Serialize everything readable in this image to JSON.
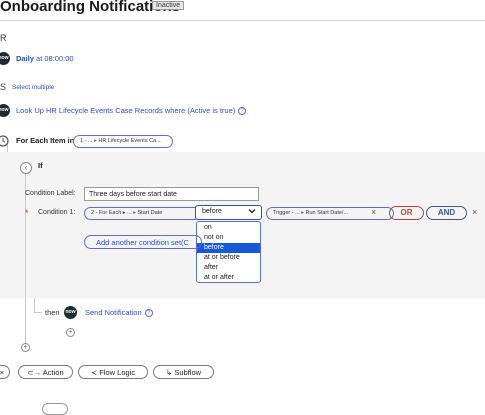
{
  "header": {
    "title": "Onboarding Notifications",
    "state_badge": "Inactive"
  },
  "trigger": {
    "section_letter": "R",
    "avatar_text": "now",
    "schedule_label": "Daily",
    "schedule_time": "at 08:00:00"
  },
  "actions_section": {
    "section_letter": "S",
    "select_multiple": "Select multiple"
  },
  "lookup_step": {
    "avatar_text": "now",
    "label": "Look Up HR Lifecycle Events Case Records where (Active is true)",
    "info_symbol": "?"
  },
  "for_each": {
    "label": "For Each Item in",
    "pill_prefix": "1 - ...",
    "pill_text": "HR Lifecycle Events Ca..."
  },
  "if_block": {
    "label": "If",
    "collapse_glyph": "‹",
    "condition_label_caption": "Condition Label:",
    "condition_label_value": "Three days before start date",
    "required_mark": "*",
    "condition_caption": "Condition 1:",
    "left_operand_prefix": "2 - For Each ▸ ...",
    "left_operand_field": "Start Date",
    "operator_selected": "before",
    "operator_options": [
      "on",
      "not on",
      "before",
      "at or before",
      "after",
      "at or after"
    ],
    "operator_highlighted_index": 2,
    "right_operand_prefix": "Trigger - ...",
    "right_operand_field": "Run Start Date/...",
    "or_label": "OR",
    "and_label": "AND",
    "add_condition_label": "Add another condition set(C"
  },
  "then_step": {
    "then_label": "then",
    "avatar_text": "now",
    "label": "Send Notification",
    "info_symbol": "?"
  },
  "bottom_toolbar": {
    "action_label": "Action",
    "flow_logic_label": "Flow Logic",
    "subflow_label": "Subflow"
  },
  "icons": {
    "plus": "+",
    "close": "×",
    "chevron_down": "chevron-down-icon"
  },
  "colors": {
    "link": "#2d4fbf",
    "highlight": "#1859d6",
    "or_button": "#b84545",
    "and_button": "#3d5a8a",
    "panel_background": "#f4f4f4"
  }
}
